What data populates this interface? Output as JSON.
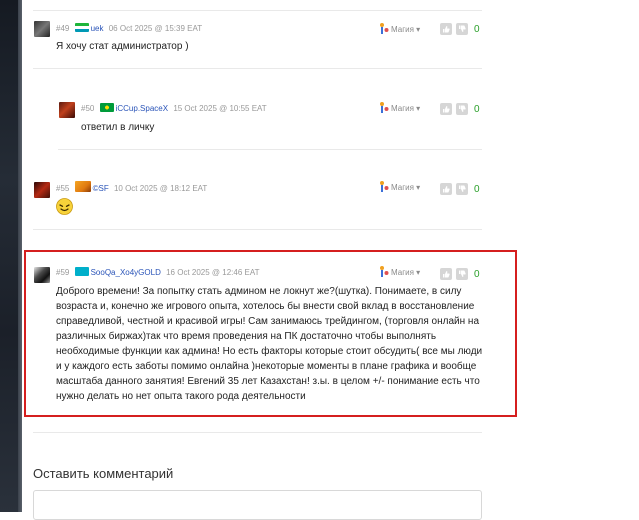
{
  "comments": [
    {
      "number": "#49",
      "user": "uek",
      "date": "06 Oct 2025 @ 15:39 EAT",
      "text": "Я хочу стат администратор )",
      "magic_label": "Магия",
      "score": "0"
    },
    {
      "number": "#50",
      "user": "iCCup.SpaceX",
      "date": "15 Oct 2025 @ 10:55 EAT",
      "text": "ответил в личку",
      "magic_label": "Магия",
      "score": "0"
    },
    {
      "number": "#55",
      "user": "©SF",
      "date": "10 Oct 2025 @ 18:12 EAT",
      "text": "",
      "magic_label": "Магия",
      "score": "0"
    },
    {
      "number": "#59",
      "user": "SooQa_Xo4yGOLD",
      "date": "16 Oct 2025 @ 12:46 EAT",
      "text_lines": [
        "Доброго времени! За попытку стать админом не локнут же?(шутка). Понимаете, в силу",
        "возраста и, конечно же игрового опыта, хотелось бы внести свой вклад в восстановление",
        "справедливой, честной и красивой игры! Сам занимаюсь трейдингом, (торговля онлайн на",
        "различных биржах)так что время проведения на ПК достаточно чтобы выполнять",
        "необходимые функции как админа! Но есть факторы которые стоит обсудить( все мы люди",
        "и у каждого есть заботы помимо онлайна )некоторые моменты в плане графика и вообще",
        "масштаба данного занятия! Евгений 35 лет Казахстан! з.ы. в целом +/- понимание есть что",
        "нужно делать но нет опыта такого рода деятельности"
      ],
      "magic_label": "Магия",
      "score": "0"
    }
  ],
  "icons": {
    "magic": "magic-wand-icon",
    "like": "thumbs-up-icon",
    "dislike": "thumbs-down-icon",
    "emoji": "smiley-emoji-icon"
  },
  "colors": {
    "username": "#2a54b8",
    "score": "#2aa02a",
    "highlight": "#d51f1f"
  },
  "form": {
    "title": "Оставить комментарий"
  }
}
